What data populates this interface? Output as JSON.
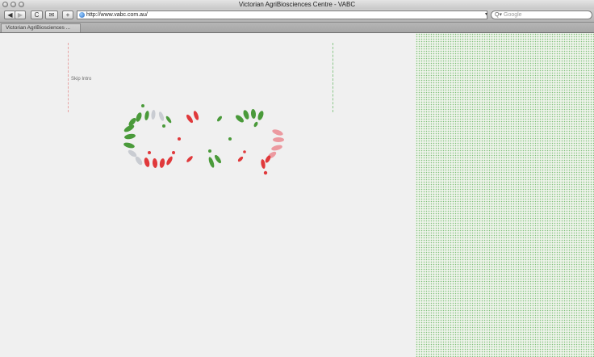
{
  "window": {
    "title": "Victorian AgriBiosciences Centre - VABC"
  },
  "toolbar": {
    "back_icon": "◀",
    "forward_icon": "▶",
    "reload_icon": "C",
    "snapback_icon": "✉",
    "add_icon": "+",
    "address": "http://www.vabc.com.au/",
    "search_placeholder": "Google",
    "search_icon": "Q▾",
    "dropdown_icon": "▾"
  },
  "tabs": [
    {
      "label": "Victorian AgriBiosciences ..."
    }
  ],
  "page": {
    "skip_intro": "Skip Intro"
  },
  "colors": {
    "green": "#4a9a3a",
    "red": "#e0393b",
    "pink": "#ec9aa0",
    "grey": "#c9ccd2",
    "line_left": "#e6a3a3",
    "line_right": "#8cc78a"
  }
}
